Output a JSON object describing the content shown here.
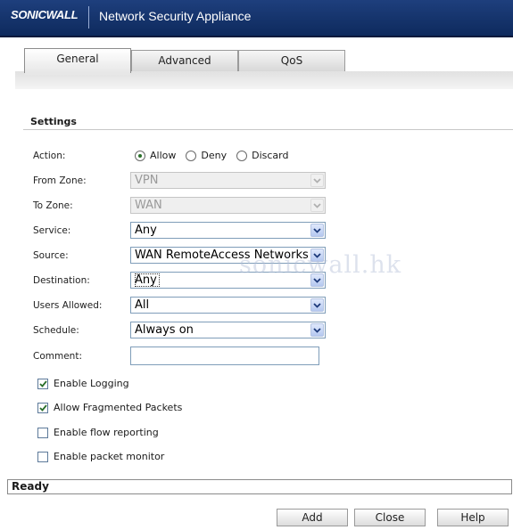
{
  "header": {
    "logo": "SONICWALL",
    "title": "Network Security Appliance"
  },
  "tabs": [
    {
      "label": "General",
      "active": true
    },
    {
      "label": "Advanced",
      "active": false
    },
    {
      "label": "QoS",
      "active": false
    }
  ],
  "settings": {
    "heading": "Settings",
    "action": {
      "label": "Action:",
      "options": [
        "Allow",
        "Deny",
        "Discard"
      ],
      "selected": "Allow"
    },
    "from_zone": {
      "label": "From Zone:",
      "value": "VPN",
      "disabled": true
    },
    "to_zone": {
      "label": "To Zone:",
      "value": "WAN",
      "disabled": true
    },
    "service": {
      "label": "Service:",
      "value": "Any"
    },
    "source": {
      "label": "Source:",
      "value": "WAN RemoteAccess Networks"
    },
    "destination": {
      "label": "Destination:",
      "value": "Any"
    },
    "users_allowed": {
      "label": "Users Allowed:",
      "value": "All"
    },
    "schedule": {
      "label": "Schedule:",
      "value": "Always on"
    },
    "comment": {
      "label": "Comment:",
      "value": ""
    },
    "checkboxes": [
      {
        "label": "Enable Logging",
        "checked": true
      },
      {
        "label": "Allow Fragmented Packets",
        "checked": true
      },
      {
        "label": "Enable flow reporting",
        "checked": false
      },
      {
        "label": "Enable packet monitor",
        "checked": false
      }
    ]
  },
  "watermark": "sonicwall.hk",
  "status": "Ready",
  "buttons": {
    "add": "Add",
    "close": "Close",
    "help": "Help"
  },
  "colors": {
    "header_bg": "#1e3f7d",
    "check_green": "#2a6f2a"
  }
}
